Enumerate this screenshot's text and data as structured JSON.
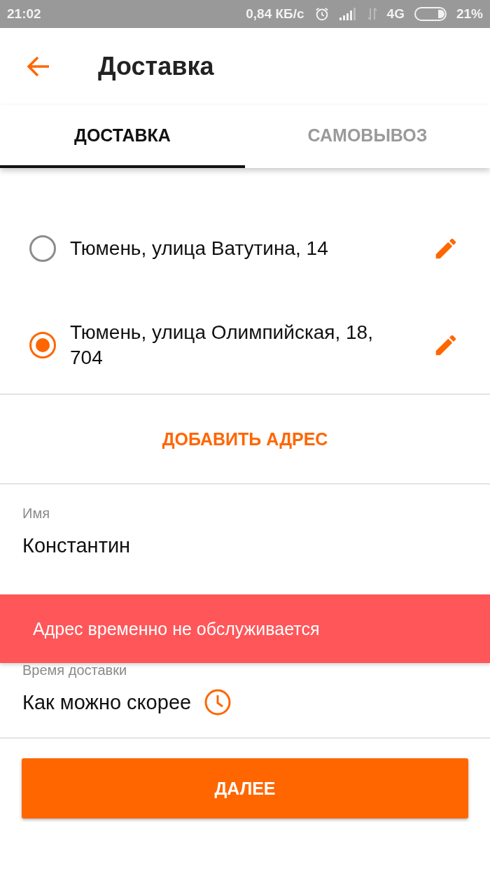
{
  "status_bar": {
    "time": "21:02",
    "net_speed": "0,84 КБ/с",
    "network": "4G",
    "battery": "21%"
  },
  "header": {
    "title": "Доставка"
  },
  "tabs": [
    {
      "label": "ДОСТАВКА",
      "selected": true
    },
    {
      "label": "САМОВЫВОЗ",
      "selected": false
    }
  ],
  "addresses": [
    {
      "text": "Тюмень, улица Ватутина, 14",
      "selected": false
    },
    {
      "text": "Тюмень, улица Олимпийская, 18, 704",
      "selected": true
    }
  ],
  "add_address_button": "ДОБАВИТЬ АДРЕС",
  "name_field": {
    "label": "Имя",
    "value": "Константин"
  },
  "snackbar": {
    "message": "Адрес временно не обслуживается"
  },
  "delivery_time": {
    "label": "Время доставки",
    "value": "Как можно скорее"
  },
  "next_button": "ДАЛЕЕ"
}
